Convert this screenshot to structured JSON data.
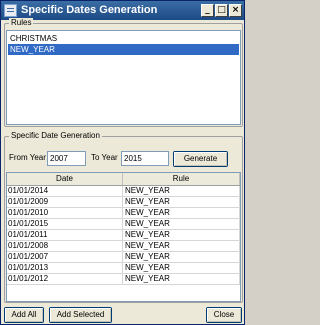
{
  "window": {
    "title": "Specific Dates Generation"
  },
  "rules_group": {
    "label": "Rules",
    "items": [
      {
        "label": "CHRISTMAS",
        "selected": false
      },
      {
        "label": "NEW_YEAR",
        "selected": true
      }
    ]
  },
  "generation_group": {
    "label": "Specific Date Generation",
    "from_year_label": "From Year",
    "from_year_value": "2007",
    "to_year_label": "To Year",
    "to_year_value": "2015",
    "generate_label": "Generate"
  },
  "grid": {
    "columns": [
      "Date",
      "Rule"
    ],
    "rows": [
      [
        "01/01/2014",
        "NEW_YEAR"
      ],
      [
        "01/01/2009",
        "NEW_YEAR"
      ],
      [
        "01/01/2010",
        "NEW_YEAR"
      ],
      [
        "01/01/2015",
        "NEW_YEAR"
      ],
      [
        "01/01/2011",
        "NEW_YEAR"
      ],
      [
        "01/01/2008",
        "NEW_YEAR"
      ],
      [
        "01/01/2007",
        "NEW_YEAR"
      ],
      [
        "01/01/2013",
        "NEW_YEAR"
      ],
      [
        "01/01/2012",
        "NEW_YEAR"
      ]
    ]
  },
  "footer": {
    "add_all_label": "Add All",
    "add_selected_label": "Add Selected",
    "close_label": "Close"
  },
  "colors": {
    "title_bar": "#2f5f98",
    "selection": "#316ac5"
  }
}
